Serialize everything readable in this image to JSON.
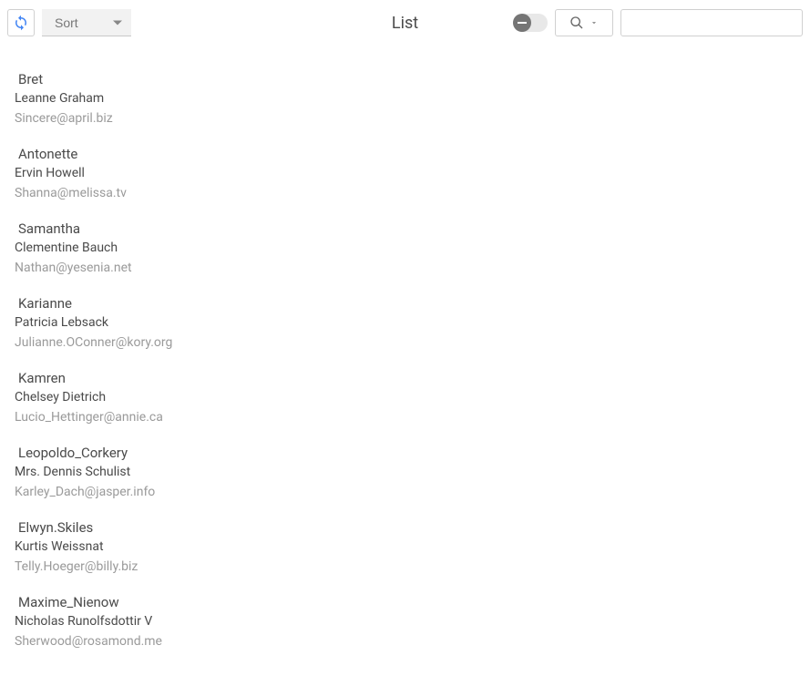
{
  "toolbar": {
    "sort_label": "Sort",
    "title": "List",
    "search_value": ""
  },
  "users": [
    {
      "username": "Bret",
      "name": "Leanne Graham",
      "email": "Sincere@april.biz"
    },
    {
      "username": "Antonette",
      "name": "Ervin Howell",
      "email": "Shanna@melissa.tv"
    },
    {
      "username": "Samantha",
      "name": "Clementine Bauch",
      "email": "Nathan@yesenia.net"
    },
    {
      "username": "Karianne",
      "name": "Patricia Lebsack",
      "email": "Julianne.OConner@kory.org"
    },
    {
      "username": "Kamren",
      "name": "Chelsey Dietrich",
      "email": "Lucio_Hettinger@annie.ca"
    },
    {
      "username": "Leopoldo_Corkery",
      "name": "Mrs. Dennis Schulist",
      "email": "Karley_Dach@jasper.info"
    },
    {
      "username": "Elwyn.Skiles",
      "name": "Kurtis Weissnat",
      "email": "Telly.Hoeger@billy.biz"
    },
    {
      "username": "Maxime_Nienow",
      "name": "Nicholas Runolfsdottir V",
      "email": "Sherwood@rosamond.me"
    }
  ]
}
